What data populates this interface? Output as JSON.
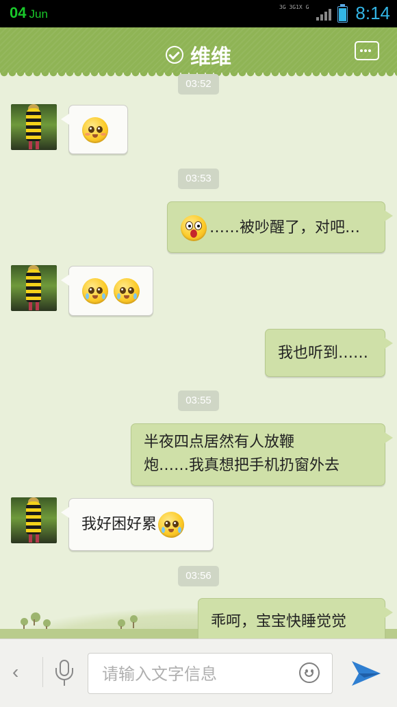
{
  "status_bar": {
    "date_day": "04",
    "date_month": "Jun",
    "network_labels": [
      "3G",
      "3G",
      "1X",
      "G"
    ],
    "time": "8:14",
    "colors": {
      "date": "#19c82a",
      "time": "#33b5e5"
    }
  },
  "header": {
    "contact_name": "维维",
    "verified_icon": "check-circle-icon",
    "menu_icon": "more-dots-icon",
    "color": "#8fb455"
  },
  "messages": [
    {
      "type": "timestamp",
      "text": "03:52"
    },
    {
      "type": "incoming",
      "emoji": [
        "shy-face"
      ]
    },
    {
      "type": "timestamp",
      "text": "03:53"
    },
    {
      "type": "outgoing",
      "emoji": [
        "shocked-face"
      ],
      "text": "……被吵醒了，对吧…"
    },
    {
      "type": "incoming",
      "emoji": [
        "crying-face",
        "crying-face"
      ]
    },
    {
      "type": "outgoing",
      "text": "我也听到……"
    },
    {
      "type": "timestamp",
      "text": "03:55"
    },
    {
      "type": "outgoing",
      "text_lines": [
        "半夜四点居然有人放鞭",
        "炮……我真想把手机扔窗外去"
      ]
    },
    {
      "type": "incoming",
      "text": "我好困好累",
      "emoji": [
        "crying-face"
      ]
    },
    {
      "type": "timestamp",
      "text": "03:56"
    },
    {
      "type": "outgoing",
      "text": "乖呵，宝宝快睡觉觉"
    }
  ],
  "input_bar": {
    "back_icon": "chevron-left-icon",
    "voice_icon": "microphone-icon",
    "placeholder": "请输入文字信息",
    "value": "",
    "emoji_icon": "smiley-icon",
    "send_icon": "paper-plane-icon",
    "send_color": "#2f7fd1"
  }
}
